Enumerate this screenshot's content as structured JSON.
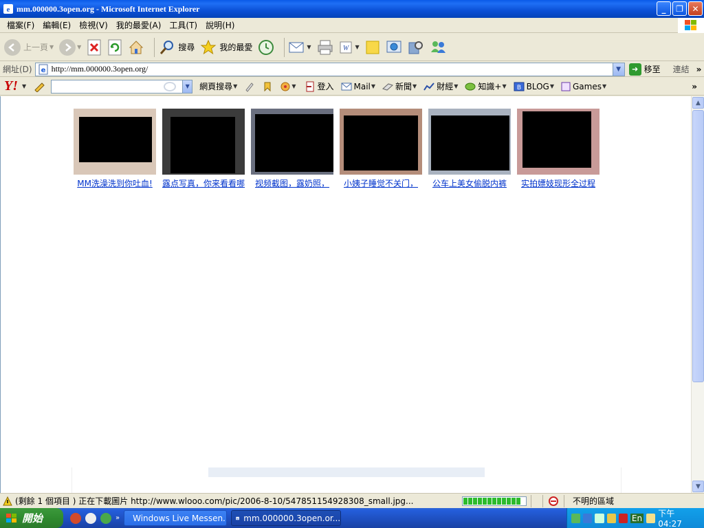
{
  "window": {
    "title": "mm.000000.3open.org - Microsoft Internet Explorer"
  },
  "menu": [
    "檔案(F)",
    "編輯(E)",
    "檢視(V)",
    "我的最愛(A)",
    "工具(T)",
    "說明(H)"
  ],
  "toolbar": {
    "back_label": "上一頁",
    "search_label": "搜尋",
    "favorites_label": "我的最愛"
  },
  "address": {
    "label": "網址(D)",
    "url": "http://mm.000000.3open.org/",
    "go_label": "移至",
    "links_label": "連結"
  },
  "yahoo": {
    "logo": "Y!",
    "web_search_label": "網頁搜尋",
    "login_label": "登入",
    "mail_label": "Mail",
    "news_label": "新聞",
    "finance_label": "財經",
    "knowledge_label": "知識+",
    "blog_label": "BLOG",
    "games_label": "Games"
  },
  "thumbnails": [
    {
      "caption": "MM洗澡洗到你吐血!",
      "tone": "#d9c7b8"
    },
    {
      "caption": "露点写真，你来看看哪",
      "tone": "#3b3b3b"
    },
    {
      "caption": "视频截图，露奶照，",
      "tone": "#6a6f7f"
    },
    {
      "caption": "小姨子睡觉不关门，",
      "tone": "#b48d7a"
    },
    {
      "caption": "公车上美女偷脱内裤",
      "tone": "#a9b2bf"
    },
    {
      "caption": "实拍嫖妓现形全过程",
      "tone": "#c89a98"
    }
  ],
  "status": {
    "text": "(剩餘 1 個項目 ) 正在下載圖片 http://www.wlooo.com/pic/2006-8-10/547851154928308_small.jpg...",
    "zone": "不明的區域"
  },
  "taskbar": {
    "start_label": "開始",
    "tasks": [
      {
        "label": "Windows Live Messen...",
        "active": false
      },
      {
        "label": "mm.000000.3open.or...",
        "active": true
      }
    ],
    "lang": "En",
    "clock": "下午 04:27"
  }
}
